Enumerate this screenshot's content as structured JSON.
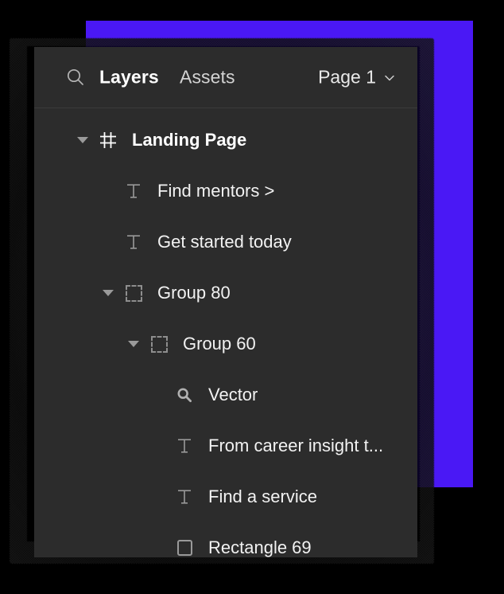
{
  "colors": {
    "accent_block": "#4a18f5",
    "panel_background": "#2c2c2c",
    "panel_border": "#3a3a3a",
    "canvas_background": "#000000",
    "text_primary": "#ffffff",
    "text_secondary": "#d3d3d3",
    "icon_muted": "#9a9a9a"
  },
  "header": {
    "search_icon": "search-icon",
    "tabs": [
      {
        "label": "Layers",
        "active": true
      },
      {
        "label": "Assets",
        "active": false
      }
    ],
    "page_selector": {
      "label": "Page 1",
      "chevron_icon": "chevron-down-icon"
    }
  },
  "layers": [
    {
      "name": "Landing Page",
      "icon": "frame-icon",
      "depth": 0,
      "expanded": true,
      "has_disclosure": true,
      "bold": true
    },
    {
      "name": "Find mentors >",
      "icon": "text-icon",
      "depth": 1,
      "expanded": false,
      "has_disclosure": false,
      "bold": false
    },
    {
      "name": "Get started today",
      "icon": "text-icon",
      "depth": 1,
      "expanded": false,
      "has_disclosure": false,
      "bold": false
    },
    {
      "name": "Group 80",
      "icon": "group-icon",
      "depth": 1,
      "expanded": true,
      "has_disclosure": true,
      "bold": false
    },
    {
      "name": "Group 60",
      "icon": "group-icon",
      "depth": 2,
      "expanded": true,
      "has_disclosure": true,
      "bold": false
    },
    {
      "name": "Vector",
      "icon": "vector-search-icon",
      "depth": 3,
      "expanded": false,
      "has_disclosure": false,
      "bold": false
    },
    {
      "name": "From career insight t...",
      "icon": "text-icon",
      "depth": 3,
      "expanded": false,
      "has_disclosure": false,
      "bold": false
    },
    {
      "name": "Find a service",
      "icon": "text-icon",
      "depth": 3,
      "expanded": false,
      "has_disclosure": false,
      "bold": false
    },
    {
      "name": "Rectangle 69",
      "icon": "rectangle-icon",
      "depth": 3,
      "expanded": false,
      "has_disclosure": false,
      "bold": false
    }
  ]
}
